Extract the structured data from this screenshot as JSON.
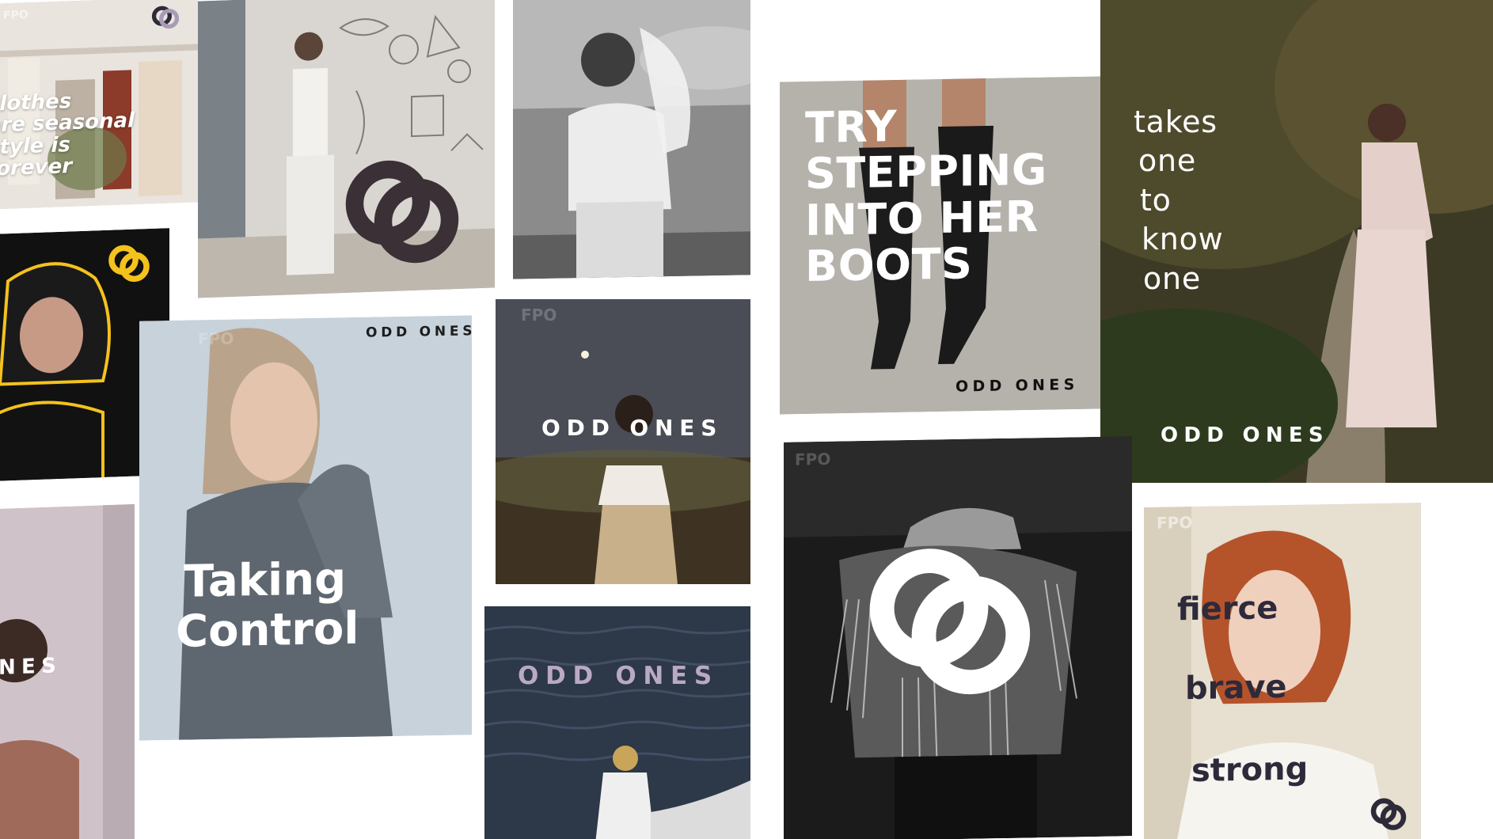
{
  "brand": "ODD ONES",
  "placeholder_mark": "FPO",
  "colors": {
    "background": "#ffffff",
    "logo_dark": "#3a3036",
    "logo_yellow": "#f3c21d",
    "logo_lavender": "#a99bb5",
    "text_white": "#ffffff",
    "text_dark": "#2d2a3a"
  },
  "icons": {
    "logo": "interlocking-rings-icon"
  },
  "tiles": {
    "clothes": {
      "lines": [
        "clothes",
        "are seasonal",
        "style is",
        "forever"
      ]
    },
    "mural": {},
    "bw_top": {},
    "boots": {
      "lines": [
        "TRY",
        "STEPPING",
        "INTO HER",
        "BOOTS"
      ],
      "brand": "ODD ONES"
    },
    "forest": {
      "lines": [
        "takes",
        "one",
        "to",
        "know",
        "one"
      ],
      "brand": "ODD ONES"
    },
    "neon": {},
    "taking": {
      "lines": [
        "Taking",
        "Control"
      ],
      "brand": "ODD ONES"
    },
    "reading": {
      "brand": "ODD ONES"
    },
    "fringe": {},
    "edge": {
      "brand": "NES"
    },
    "sea": {
      "brand": "ODD ONES"
    },
    "redhead": {
      "lines": [
        "fierce",
        "brave",
        "strong"
      ]
    }
  }
}
